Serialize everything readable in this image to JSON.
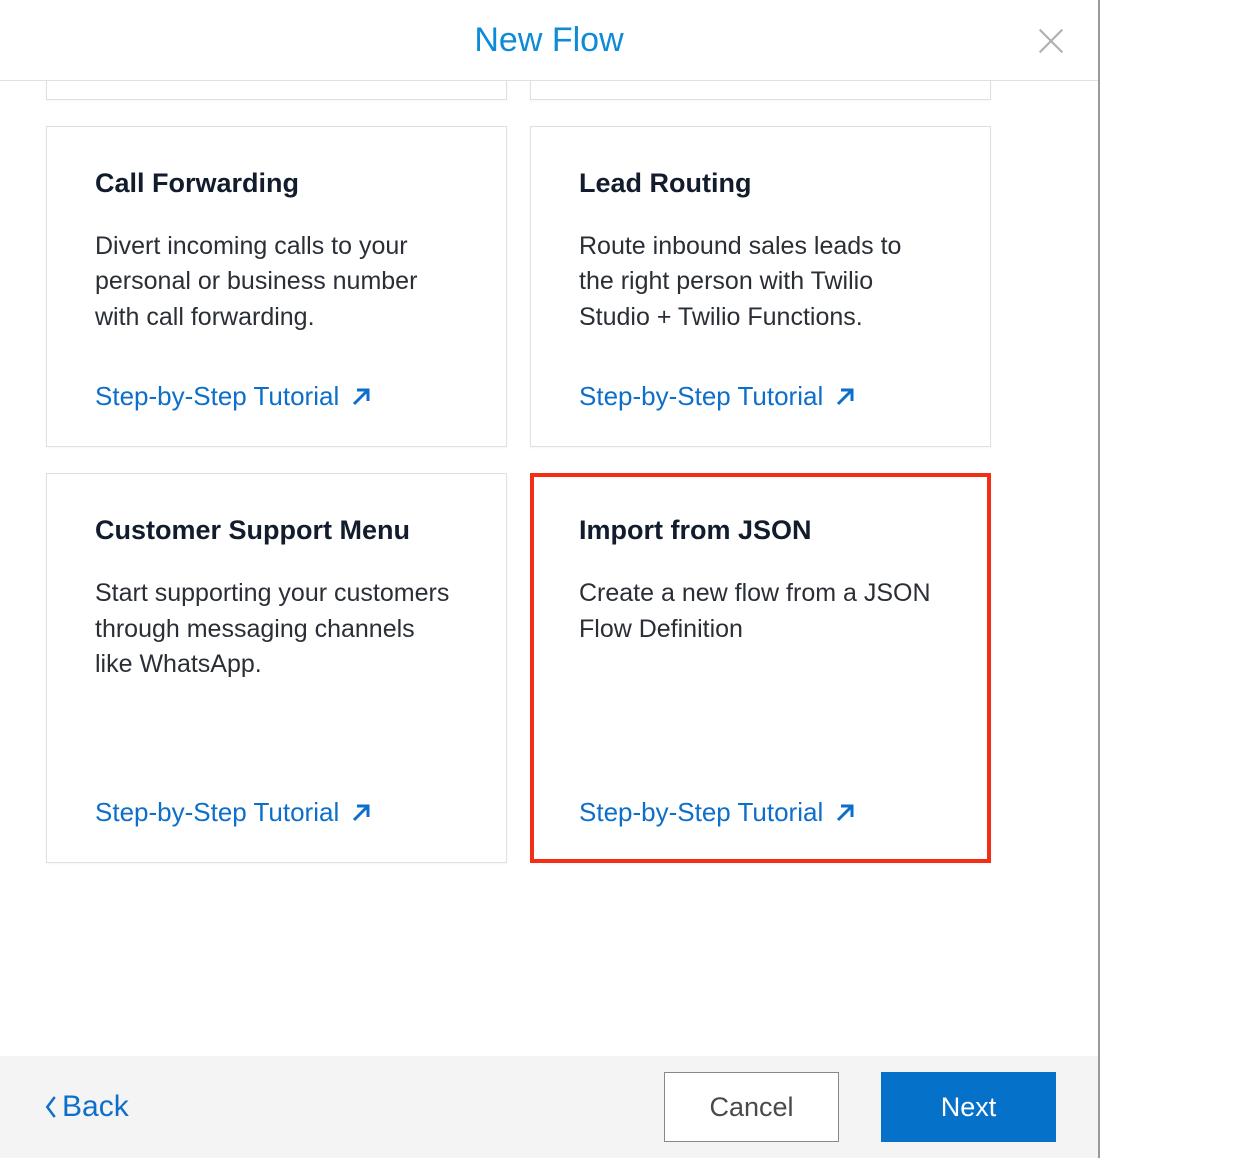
{
  "header": {
    "title": "New Flow"
  },
  "link_label": "Step-by-Step Tutorial",
  "cards": [
    {
      "id": "partial-left",
      "title": "",
      "desc": ""
    },
    {
      "id": "partial-right",
      "title": "",
      "desc": ""
    },
    {
      "id": "call-forwarding",
      "title": "Call Forwarding",
      "desc": "Divert incoming calls to your personal or business number with call forwarding."
    },
    {
      "id": "lead-routing",
      "title": "Lead Routing",
      "desc": "Route inbound sales leads to the right person with Twilio Studio + Twilio Functions."
    },
    {
      "id": "customer-support-menu",
      "title": "Customer Support Menu",
      "desc": "Start supporting your customers through messaging channels like WhatsApp."
    },
    {
      "id": "import-from-json",
      "title": "Import from JSON",
      "desc": "Create a new flow from a JSON Flow Definition",
      "selected": true
    }
  ],
  "footer": {
    "back": "Back",
    "cancel": "Cancel",
    "next": "Next"
  }
}
